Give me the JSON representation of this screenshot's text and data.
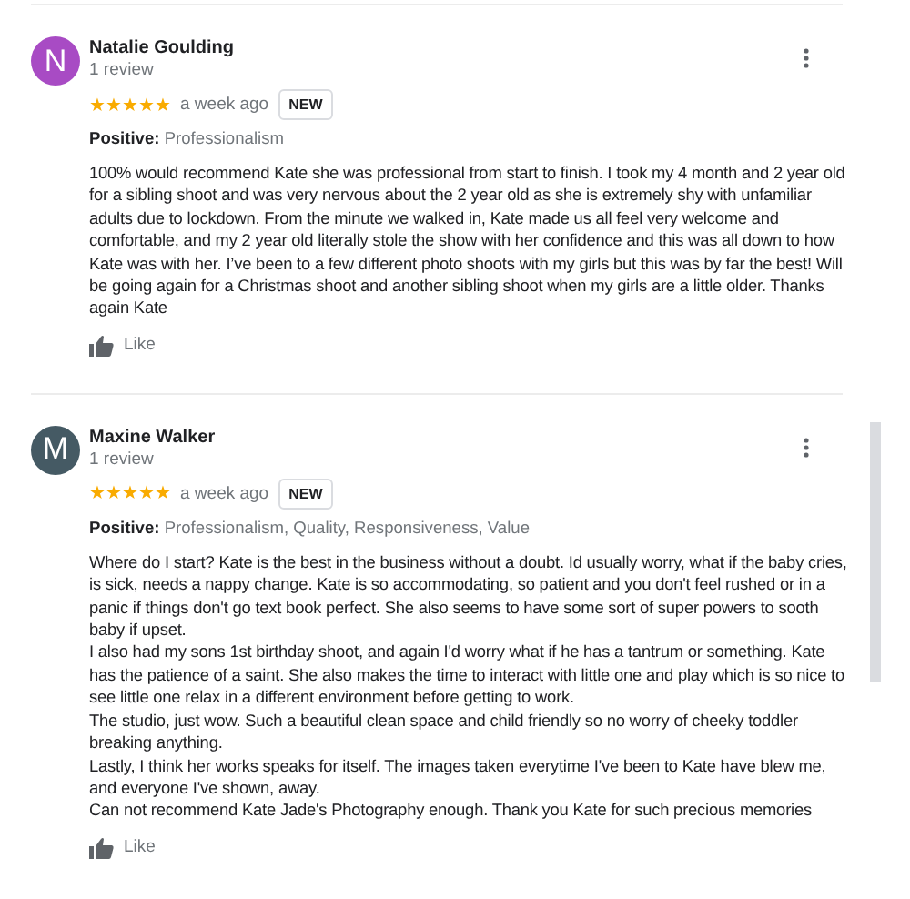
{
  "reviews": [
    {
      "avatar_letter": "N",
      "color": "#a84bc4",
      "name": "Natalie Goulding",
      "review_count": "1 review",
      "stars": 5,
      "time": "a week ago",
      "badge": "NEW",
      "positive_label": "Positive:",
      "positive_values": "Professionalism",
      "paragraphs": [
        "100% would recommend Kate she was professional from start to finish. I took my 4 month and 2 year old for a sibling shoot and was very nervous about the 2 year old as she is extremely shy with unfamiliar adults due to lockdown. From the minute we walked in, Kate made us all feel very welcome and comfortable, and my 2 year old literally stole the show with her confidence and this was all down to how Kate was with her. I’ve been to a few different photo shoots with my girls but this was by far the best! Will be going again for a Christmas shoot and another sibling shoot when my girls are a little older. Thanks again Kate"
      ],
      "like": "Like"
    },
    {
      "avatar_letter": "M",
      "color": "#455a64",
      "name": "Maxine Walker",
      "review_count": "1 review",
      "stars": 5,
      "time": "a week ago",
      "badge": "NEW",
      "positive_label": "Positive:",
      "positive_values": "Professionalism, Quality, Responsiveness, Value",
      "paragraphs": [
        "Where do I start? Kate is the best in the business without a doubt. Id usually worry, what if the baby cries, is sick, needs a nappy change. Kate is so accommodating, so patient and you don't feel rushed or in a panic if things don't go text book perfect. She also seems to have some sort of super powers to sooth baby if upset.",
        "I also had my sons 1st birthday shoot, and again I'd worry what if he has a tantrum or something. Kate has the patience of a saint. She also makes the time to interact with little one and play which is so nice to see little one relax in a different environment before getting to work.",
        "The studio, just wow. Such a beautiful clean space and child friendly so no worry of cheeky toddler breaking anything.",
        "Lastly, I think her works speaks for itself. The images taken everytime I've been to Kate have blew me, and everyone I've shown, away.",
        "Can not recommend Kate Jade's Photography enough. Thank you Kate for such precious memories"
      ],
      "like": "Like"
    }
  ]
}
